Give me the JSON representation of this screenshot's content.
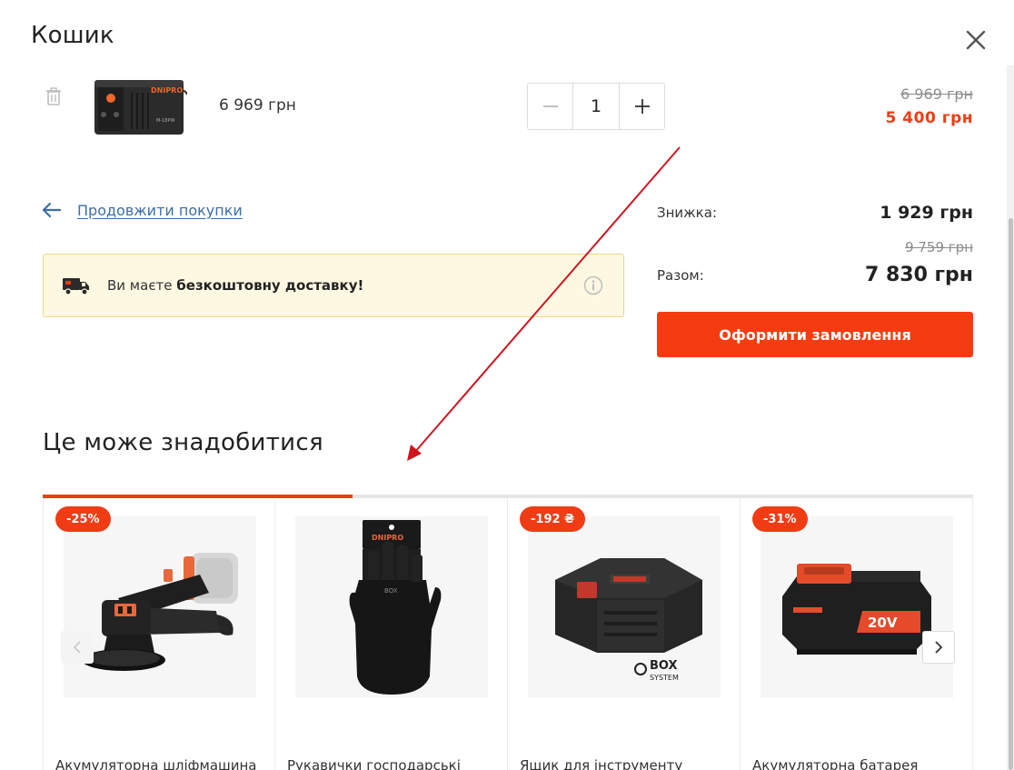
{
  "header": {
    "title": "Кошик",
    "close_icon": "close-icon"
  },
  "cart_item": {
    "price": "6 969 грн",
    "quantity": "1",
    "old_price": "6 969 грн",
    "new_price": "5 400 грн"
  },
  "continue": {
    "label": "Продовжити покупки"
  },
  "delivery": {
    "text_prefix": "Ви маєте",
    "text_bold": "безкоштовну доставку!"
  },
  "summary": {
    "discount_label": "Знижка:",
    "discount_value": "1 929 грн",
    "total_old": "9 759 грн",
    "total_label": "Разом:",
    "total_value": "7 830 грн",
    "checkout_label": "Оформити замовлення"
  },
  "recommendations": {
    "title": "Це може знадобитися",
    "progress": 0.333,
    "items": [
      {
        "badge": "-25%",
        "name": "Акумуляторна шліфмашина"
      },
      {
        "badge": "",
        "name": "Рукавички господарські"
      },
      {
        "badge": "-192 ₴",
        "name": "Ящик для інструменту"
      },
      {
        "badge": "-31%",
        "name": "Акумуляторна батарея"
      }
    ]
  },
  "product_logos": {
    "brand": "DNIPRO-M",
    "box_logo_line1": "BOX",
    "box_logo_line2": "SYSTEM",
    "battery_label": "20V"
  },
  "colors": {
    "accent": "#f03c15",
    "link": "#3b6ea8",
    "banner_bg": "#fdf8e1",
    "annotation_arrow": "#d0141e"
  }
}
